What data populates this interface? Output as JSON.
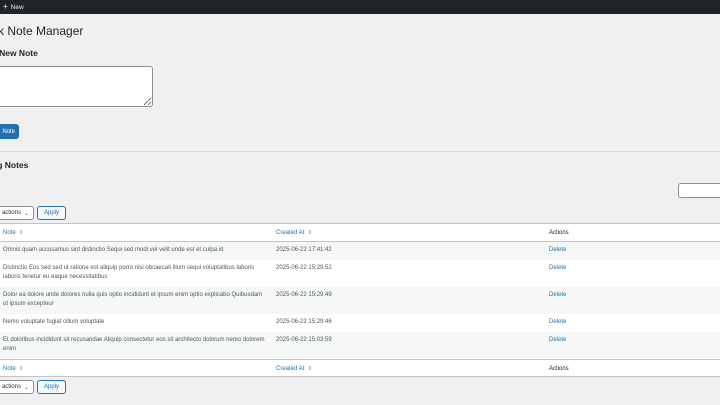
{
  "adminbar": {
    "new_label": "New",
    "plus_icon": "+"
  },
  "page_title": "ck Note Manager",
  "add_section": {
    "title": "a New Note",
    "textarea_value": "",
    "button_label": "Note"
  },
  "existing_section": {
    "title": "ng Notes"
  },
  "search": {
    "value": ""
  },
  "bulk_top": {
    "select_label": "actions",
    "apply_label": "Apply"
  },
  "bulk_bottom": {
    "select_label": "actions",
    "apply_label": "Apply"
  },
  "table": {
    "headers": {
      "note": "Note",
      "created_at": "Created At",
      "actions": "Actions"
    },
    "rows": [
      {
        "note": "Omnis quam accusamus sint distinctio Sequi sed modi vel velit unde est et culpa id",
        "created_at": "2025-06-22 17:41:42",
        "action": "Delete"
      },
      {
        "note": "Distinctio Eos sed sed ut ratione est aliquip porro nisi obcaecati illum sequi voluptatibus laboris laboris tenetur eu eaque necessitatibus",
        "created_at": "2025-06-22 15:29:52",
        "action": "Delete"
      },
      {
        "note": "Dolor ea dolore unde dolores nulla quis optio incididunt et ipsum enim optio explicabo Quibusdam ut ipsum excepteur",
        "created_at": "2025-06-22 15:29:49",
        "action": "Delete"
      },
      {
        "note": "Nemo voluptate fugiat cillum voluptate",
        "created_at": "2025-06-22 15:29:46",
        "action": "Delete"
      },
      {
        "note": "Et doloribus incididunt sit recusandae Aliquip consectetur eos sit architecto dolorum nemo dolorem enim",
        "created_at": "2025-06-22 15:03:59",
        "action": "Delete"
      }
    ],
    "footers": {
      "note": "Note",
      "created_at": "Created At",
      "actions": "Actions"
    }
  },
  "colors": {
    "adminbar": "#1d2327",
    "accent": "#2271b1",
    "background": "#f0f0f1"
  },
  "icons": {
    "sort": "sort-arrows-icon",
    "select_chevron": "chevron-down-icon",
    "plus": "plus-icon"
  }
}
